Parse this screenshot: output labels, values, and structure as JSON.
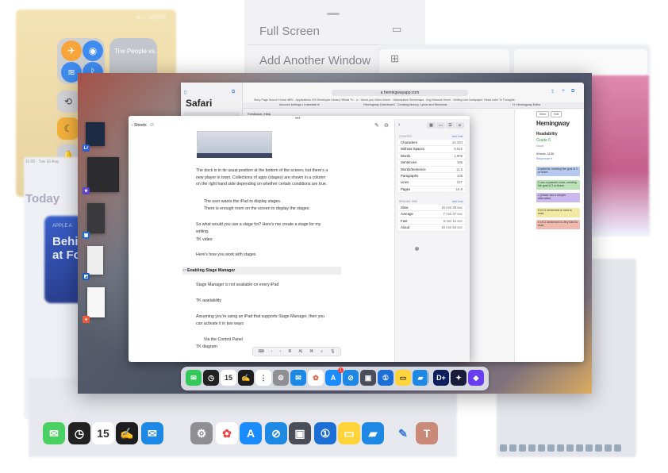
{
  "control_center": {
    "status": "▾ ⌁ 100%",
    "music_title": "The People vs...",
    "icons": [
      "airplane-icon",
      "airdrop-icon",
      "wifi-icon",
      "bluetooth-icon",
      "rotation-lock-icon",
      "screen-mirror-icon",
      "focus-icon",
      "sound-icon"
    ]
  },
  "today_card": {
    "time": "11:00 · Tue 16 Aug",
    "label": "Today",
    "story_tag": "APPLE A",
    "story_title": "Behi\nat Fo"
  },
  "window_menu": {
    "full_screen": "Full Screen",
    "add_window": "Add Another Window"
  },
  "safari": {
    "title": "Safari",
    "url": "a  hemingwayapp.com",
    "bookmarks": "Story Page Source   Home dBSI - Applications   iOS Developer Library   Official TV - a ~ About you   Video Inform - Marketplace   Stonemaps - Img Network   Home - Writing Line   Instapaper: Read Later   To Thoughts   Pocket   Popular   Readability   Irish Inmatu",
    "tab1": "Account settings • Instadata le",
    "tab2": "Hemingway Dashboard - Creating factory, Lyrics and Memorial",
    "tab3": "H: Hemingway Editor",
    "menu": "Feedback  |  Help"
  },
  "hemingway": {
    "logo": "Hemingway",
    "mode_buttons": [
      "Write",
      "Edit"
    ],
    "readability": "Readability",
    "grade": "Grade 6",
    "grade_note": "Good",
    "words": "Words: 1135",
    "show_more": "Show more ▾",
    "notes": [
      {
        "text": "8 adverbs, meeting the goal of 2 or fewer.",
        "color": "#b7c8ef"
      },
      {
        "text": "2 use of passive voice, meeting the goal of 2 or fewer.",
        "color": "#b9e3b7"
      },
      {
        "text": "1 phrase has a simpler alternative.",
        "color": "#cbb9ee"
      },
      {
        "text": "5 of 11 sentences is hard to read.",
        "color": "#f3e9a6"
      },
      {
        "text": "0 of 11 sentences is very hard to read.",
        "color": "#f1b8b0"
      }
    ]
  },
  "writer": {
    "back_label": "Sheets",
    "paragraphs": [
      "The dock is in its usual position at the bottom of the screen, but there’s a new player in town.  Collections of apps (stages) are shown in a column on the right hand side depending on whether certain conditions are true.",
      "The user wants the iPad to display stages.",
      "There is enough room on the screen to display the stages.",
      "So what would you use a stage for? Here’s me create a stage for my writing.",
      "TK video",
      "Here’s how you work with stages",
      "Stage Manager is not available on every iPad",
      "TK availability",
      "Assuming you’re using an iPad that supports Stage Manager, then you can activate it in two ways",
      "Via the Control Panel",
      "TK diagram"
    ],
    "heading_marker": "##",
    "heading": "Enabling Stage Manager",
    "format_bar": [
      "⌨",
      "‹",
      "›",
      "≣",
      "A|",
      "⌘",
      "⌕",
      "🎙"
    ]
  },
  "stats": {
    "counter_header": "COUNTER",
    "counter_add": "Add Goal",
    "counters": [
      {
        "label": "Characters",
        "value": "10,324"
      },
      {
        "label": "Without Spaces",
        "value": "8,922"
      },
      {
        "label": "Words",
        "value": "1,909"
      },
      {
        "label": "Sentences",
        "value": "165"
      },
      {
        "label": "Words/Sentence",
        "value": "11.6"
      },
      {
        "label": "Paragraphs",
        "value": "108"
      },
      {
        "label": "Lines",
        "value": "227"
      },
      {
        "label": "Pages",
        "value": "10.9"
      }
    ],
    "reading_header": "READING TIME",
    "reading_add": "Add Goal",
    "reading": [
      {
        "label": "Slow",
        "value": "15 min 39 sec"
      },
      {
        "label": "Average",
        "value": "7 min 37 sec"
      },
      {
        "label": "Fast",
        "value": "6 min 11 sec"
      },
      {
        "label": "Aloud",
        "value": "15 min 54 sec"
      }
    ]
  },
  "dock": {
    "items": [
      {
        "name": "messages-icon",
        "glyph": "✉",
        "color": "#34c759"
      },
      {
        "name": "clock-icon",
        "glyph": "◷",
        "color": "#222222"
      },
      {
        "name": "calendar-icon",
        "glyph": "15",
        "color": "#ffffff"
      },
      {
        "name": "signature-icon",
        "glyph": "✍",
        "color": "#1d1d1f"
      },
      {
        "name": "reminders-icon",
        "glyph": "⋮",
        "color": "#ffffff"
      },
      {
        "name": "settings-icon",
        "glyph": "⚙",
        "color": "#8e8e93"
      },
      {
        "name": "mail-icon",
        "glyph": "✉",
        "color": "#1e88e5"
      },
      {
        "name": "photos-icon",
        "glyph": "✿",
        "color": "#ffffff"
      },
      {
        "name": "app-store-icon",
        "glyph": "A",
        "color": "#1a8cff"
      },
      {
        "name": "safari-icon",
        "glyph": "⊘",
        "color": "#1e88e5"
      },
      {
        "name": "screens-icon",
        "glyph": "▣",
        "color": "#4a4e58"
      },
      {
        "name": "onepassword-icon",
        "glyph": "①",
        "color": "#1d6fd6"
      },
      {
        "name": "notes-icon",
        "glyph": "▭",
        "color": "#ffd43b"
      },
      {
        "name": "files-icon",
        "glyph": "▰",
        "color": "#1e88e5"
      },
      {
        "name": "disney-plus-icon",
        "glyph": "D+",
        "color": "#0b1f5c"
      },
      {
        "name": "tes-butterfly-icon",
        "glyph": "✦",
        "color": "#1b1b3a"
      },
      {
        "name": "shortcuts-icon",
        "glyph": "◆",
        "color": "#6a3df0"
      }
    ],
    "badge": "1"
  },
  "background_dock": {
    "items": [
      "messages-icon",
      "clock-icon",
      "calendar-icon",
      "signature-icon",
      "mail-icon",
      "settings-icon",
      "photos-icon",
      "app-store-icon",
      "safari-icon",
      "screens-icon",
      "onepassword-icon",
      "notes-icon",
      "files-icon",
      "pencil-icon",
      "typeface-icon"
    ]
  }
}
